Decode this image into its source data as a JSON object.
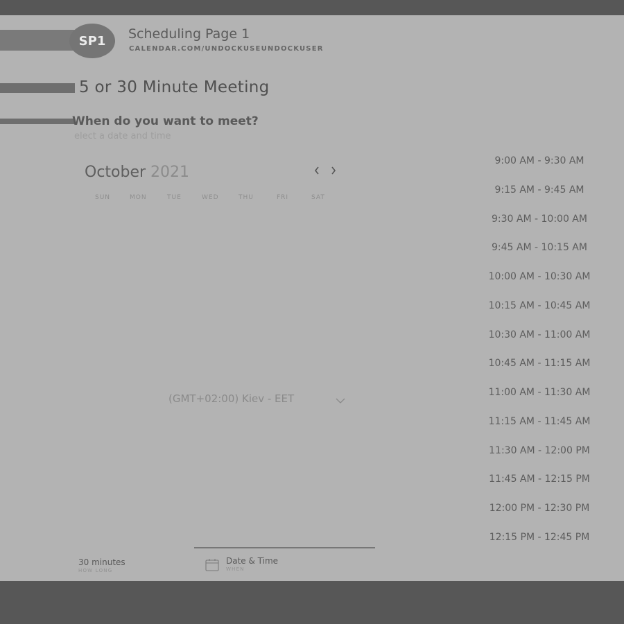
{
  "header": {
    "avatar_initials": "SP1",
    "title": "Scheduling Page 1",
    "url": "CALENDAR.COM/UNDOCKUSEUNDOCKUSER"
  },
  "meeting": {
    "title": "5 or 30 Minute Meeting",
    "question": "When do you want to meet?",
    "hint": "elect a date and time"
  },
  "calendar": {
    "month": "October",
    "year": "2021",
    "prev_icon": "chevron-left-icon",
    "next_icon": "chevron-right-icon",
    "weekdays": [
      "SUN",
      "MON",
      "TUE",
      "WED",
      "THU",
      "FRI",
      "SAT"
    ]
  },
  "timezone": {
    "value": "(GMT+02:00) Kiev - EET",
    "icon": "chevron-down-icon"
  },
  "slots": [
    "9:00 AM - 9:30 AM",
    "9:15 AM - 9:45 AM",
    "9:30 AM - 10:00 AM",
    "9:45 AM - 10:15 AM",
    "10:00 AM - 10:30 AM",
    "10:15 AM - 10:45 AM",
    "10:30 AM - 11:00 AM",
    "10:45 AM - 11:15 AM",
    "11:00 AM - 11:30 AM",
    "11:15 AM - 11:45 AM",
    "11:30 AM - 12:00 PM",
    "11:45 AM - 12:15 PM",
    "12:00 PM - 12:30 PM",
    "12:15 PM - 12:45 PM"
  ],
  "footer": {
    "duration_value": "30 minutes",
    "duration_label": "HOW LONG",
    "datetime_value": "Date & Time",
    "datetime_label": "WHEN",
    "calendar_icon": "calendar-icon"
  },
  "colors": {
    "overlay": "#575757",
    "page_background": "#b3b3b3",
    "avatar": "#757575"
  }
}
